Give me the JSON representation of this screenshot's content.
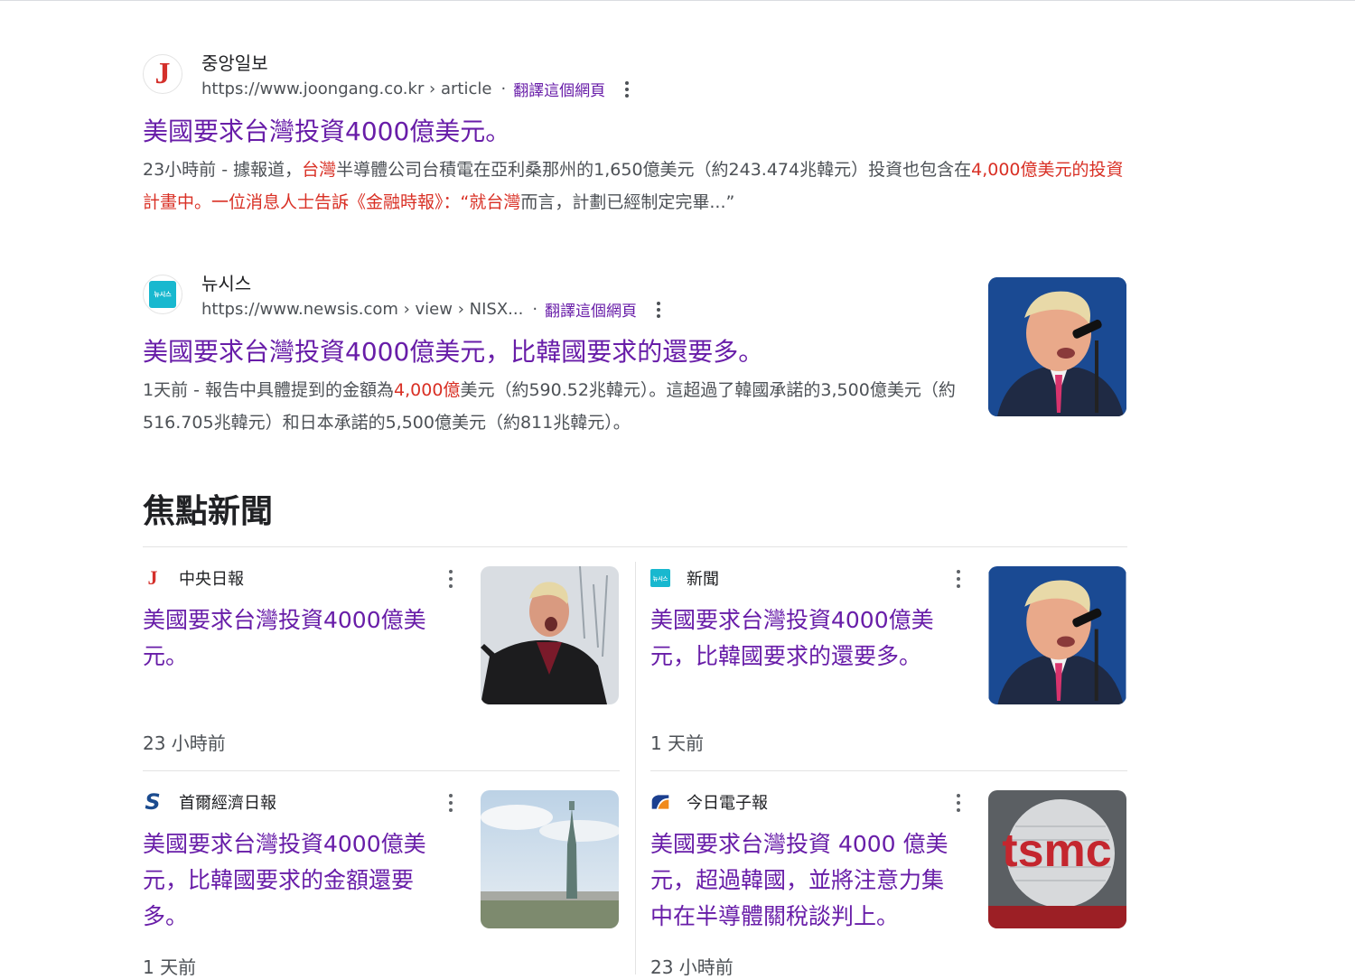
{
  "results": [
    {
      "site_name": "중앙일보",
      "url": "https://www.joongang.co.kr › article",
      "translate_label": "翻譯這個網頁",
      "title": "美國要求台灣投資4000億美元。",
      "snippet_parts": [
        {
          "text": "23小時前 - 據報道，",
          "hl": false
        },
        {
          "text": "台灣",
          "hl": true
        },
        {
          "text": "半導體公司台積電在亞利桑那州的1,650億美元（約243.474兆韓元）投資也包含在",
          "hl": false
        },
        {
          "text": "4,000億美元的投資計畫中。一位消息人士告訴《金融時報》：“就台灣",
          "hl": true
        },
        {
          "text": "而言，計劃已經制定完畢...”",
          "hl": false
        }
      ]
    },
    {
      "site_name": "뉴시스",
      "favicon_text": "뉴시스",
      "url": "https://www.newsis.com › view › NISX...",
      "translate_label": "翻譯這個網頁",
      "title": "美國要求台灣投資4000億美元，比韓國要求的還要多。",
      "snippet_parts": [
        {
          "text": "1天前 - 報告中具體提到的金額為",
          "hl": false
        },
        {
          "text": "4,000億",
          "hl": true
        },
        {
          "text": "美元（約590.52兆韓元）。這超過了韓國承諾的3,500億美元（約516.705兆韓元）和日本承諾的5,500億美元（約811兆韓元）。",
          "hl": false
        }
      ]
    }
  ],
  "top_stories": {
    "heading": "焦點新聞",
    "cards": [
      {
        "source": "中央日報",
        "icon": "joongang-j-icon",
        "title": "美國要求台灣投資4000億美元。",
        "time": "23 小時前"
      },
      {
        "source": "新聞",
        "icon": "newsis-icon",
        "icon_text": "뉴시스",
        "title": "美國要求台灣投資4000億美元，比韓國要求的還要多。",
        "time": "1 天前"
      },
      {
        "source": "首爾經濟日報",
        "icon": "sedaily-s-icon",
        "icon_text": "S",
        "title": "美國要求台灣投資4000億美元，比韓國要求的金額還要多。",
        "time": "1 天前"
      },
      {
        "source": "今日電子報",
        "icon": "etoday-icon",
        "title": "美國要求台灣投資 4000 億美元，超過韓國，並將注意力集中在半導體關稅談判上。",
        "time": "23 小時前"
      }
    ]
  },
  "images": {
    "tsmc_logo_text": "tsmc"
  },
  "colors": {
    "link_visited": "#681da8",
    "highlight": "#d93025",
    "snippet": "#4d5156"
  }
}
